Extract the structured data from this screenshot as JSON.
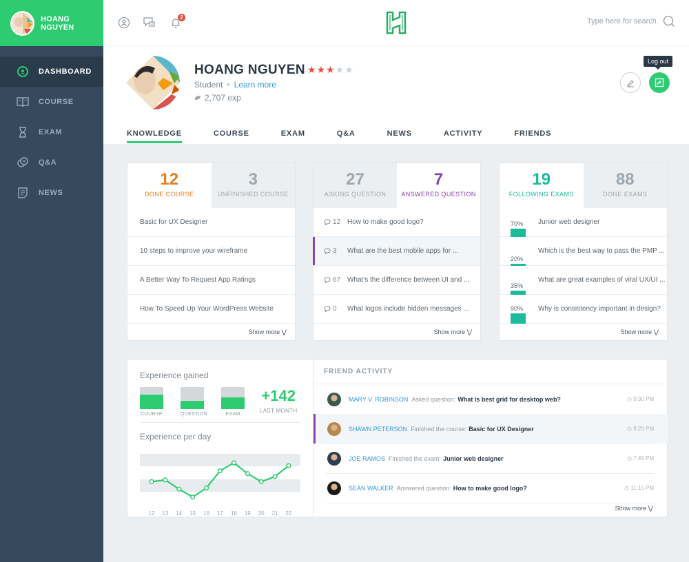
{
  "sidebar": {
    "user_name": "HOANG NGUYEN",
    "items": [
      {
        "label": "DASHBOARD",
        "icon": "dashboard-icon",
        "active": true
      },
      {
        "label": "COURSE",
        "icon": "book-icon",
        "active": false
      },
      {
        "label": "EXAM",
        "icon": "hourglass-icon",
        "active": false
      },
      {
        "label": "Q&A",
        "icon": "chat-bubbles-icon",
        "active": false
      },
      {
        "label": "NEWS",
        "icon": "document-icon",
        "active": false
      }
    ]
  },
  "topbar": {
    "notification_count": "2",
    "search_placeholder": "Type here for search",
    "icons": [
      "profile-icon",
      "messages-icon",
      "bell-icon",
      "search-icon"
    ]
  },
  "profile": {
    "name": "HOANG NGUYEN",
    "rating": 3,
    "rating_max": 5,
    "role": "Student",
    "learn_more": "Learn more",
    "exp": "2,707 exp",
    "logout_tooltip": "Log out"
  },
  "tabs": [
    "KNOWLEDGE",
    "COURSE",
    "EXAM",
    "Q&A",
    "NEWS",
    "ACTIVITY",
    "FRIENDS"
  ],
  "courses": {
    "tabs": [
      {
        "num": "12",
        "label": "DONE COURSE",
        "color": "#e67e22"
      },
      {
        "num": "3",
        "label": "UNFINISHED COURSE",
        "color": "#9ea7ae"
      }
    ],
    "items": [
      "Basic for UX Designer",
      "10 steps to improve your wireframe",
      "A Better Way To Request App Ratings",
      "How To Speed Up Your WordPress Website"
    ],
    "show_more": "Show more"
  },
  "questions": {
    "tabs": [
      {
        "num": "27",
        "label": "ASKING QUESTION",
        "color": "#9ea7ae"
      },
      {
        "num": "7",
        "label": "ANSWERED QUESTION",
        "color": "#8e44ad"
      }
    ],
    "items": [
      {
        "count": "12",
        "text": "How to make good logo?"
      },
      {
        "count": "3",
        "text": "What are the best mobile apps for ..."
      },
      {
        "count": "67",
        "text": "What's the difference between UI and ..."
      },
      {
        "count": "0",
        "text": "What logos include hidden messages ..."
      }
    ],
    "show_more": "Show more"
  },
  "exams": {
    "tabs": [
      {
        "num": "19",
        "label": "FOLLOWING EXAMS",
        "color": "#1abc9c"
      },
      {
        "num": "88",
        "label": "DONE EXAMS",
        "color": "#9ea7ae"
      }
    ],
    "items": [
      {
        "pct_label": "70%",
        "pct": 70,
        "text": "Junior web designer"
      },
      {
        "pct_label": "20%",
        "pct": 20,
        "text": "Which is the best way to pass the PMP ..."
      },
      {
        "pct_label": "35%",
        "pct": 35,
        "text": "What are great examples of viral UX/UI ..."
      },
      {
        "pct_label": "90%",
        "pct": 90,
        "text": "Why is consistency important in design?"
      }
    ],
    "show_more": "Show more"
  },
  "experience": {
    "title": "Experience gained",
    "bars": [
      {
        "label": "COURSE",
        "fill": 0.65
      },
      {
        "label": "QUESTION",
        "fill": 0.38
      },
      {
        "label": "EXAM",
        "fill": 0.52
      }
    ],
    "total": "+142",
    "total_label": "LAST MONTH",
    "per_day_title": "Experience per day"
  },
  "chart_data": {
    "type": "line",
    "title": "Experience per day",
    "x": [
      "12",
      "13",
      "14",
      "15",
      "16",
      "17",
      "18",
      "19",
      "20",
      "21",
      "22"
    ],
    "series": [
      {
        "name": "Experience",
        "values": [
          55,
          58,
          42,
          28,
          44,
          74,
          88,
          69,
          55,
          64,
          83
        ]
      }
    ],
    "ylim": [
      0,
      100
    ],
    "xlabel": "",
    "ylabel": "",
    "grid": true,
    "color": "#2ecc71"
  },
  "friend_activity": {
    "title": "FRIEND ACTIVITY",
    "items": [
      {
        "user": "MARY V. ROBINSON",
        "action": "Asked question:",
        "object": "What is best grid for desktop web?",
        "time": "9:30 PM",
        "highlight": false
      },
      {
        "user": "SHAWN PETERSON",
        "action": "Finished the course:",
        "object": "Basic for UX Designer",
        "time": "9:20 PM",
        "highlight": true
      },
      {
        "user": "JOE RAMOS",
        "action": "Finished the exam:",
        "object": "Junior web designer",
        "time": "7:45 PM",
        "highlight": false
      },
      {
        "user": "SEAN WALKER",
        "action": "Answered question:",
        "object": "How to make good logo?",
        "time": "11:15 PM",
        "highlight": false
      }
    ],
    "show_more": "Show more"
  }
}
